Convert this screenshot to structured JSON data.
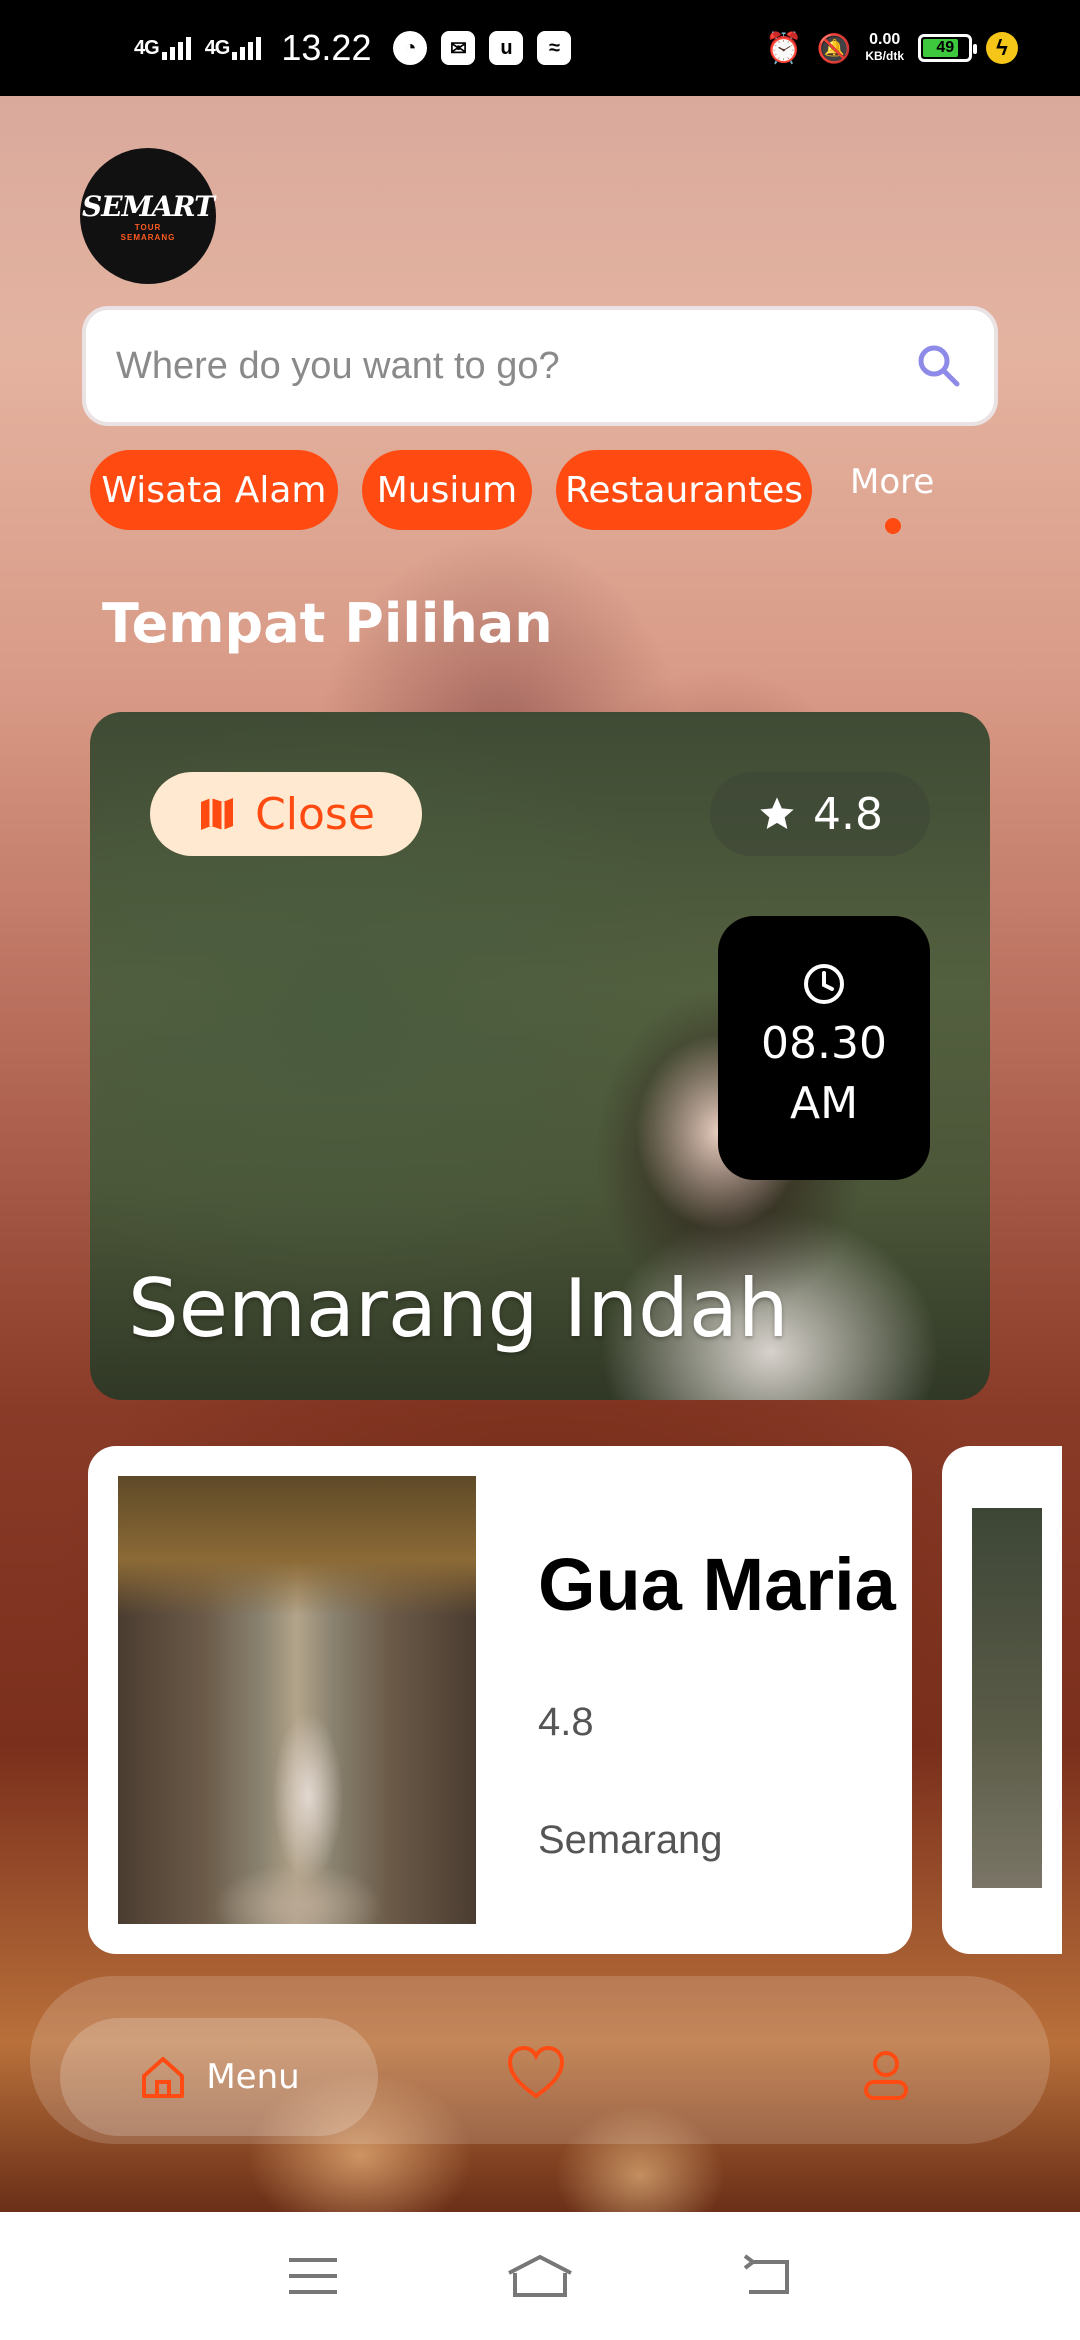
{
  "status_bar": {
    "net1": "4G",
    "net2": "4G",
    "time": "13.22",
    "speed_value": "0.00",
    "speed_unit": "KB/dtk",
    "battery": "49"
  },
  "logo": {
    "main": "SEMART",
    "sub1": "TOUR",
    "sub2": "SEMARANG"
  },
  "search": {
    "placeholder": "Where do you want to go?"
  },
  "categories": [
    {
      "label": "Wisata Alam"
    },
    {
      "label": "Musium"
    },
    {
      "label": "Restaurantes"
    }
  ],
  "more_label": "More",
  "section_title": "Tempat Pilihan",
  "featured": {
    "status_label": "Close",
    "rating": "4.8",
    "time_line1": "08.30",
    "time_line2": "AM",
    "title": "Semarang Indah"
  },
  "places": [
    {
      "name": "Gua Maria",
      "rating": "4.8",
      "city": "Semarang"
    }
  ],
  "bottom_nav": {
    "menu_label": "Menu"
  },
  "colors": {
    "accent": "#ff4b12",
    "close_bg": "#ffe9d0"
  }
}
